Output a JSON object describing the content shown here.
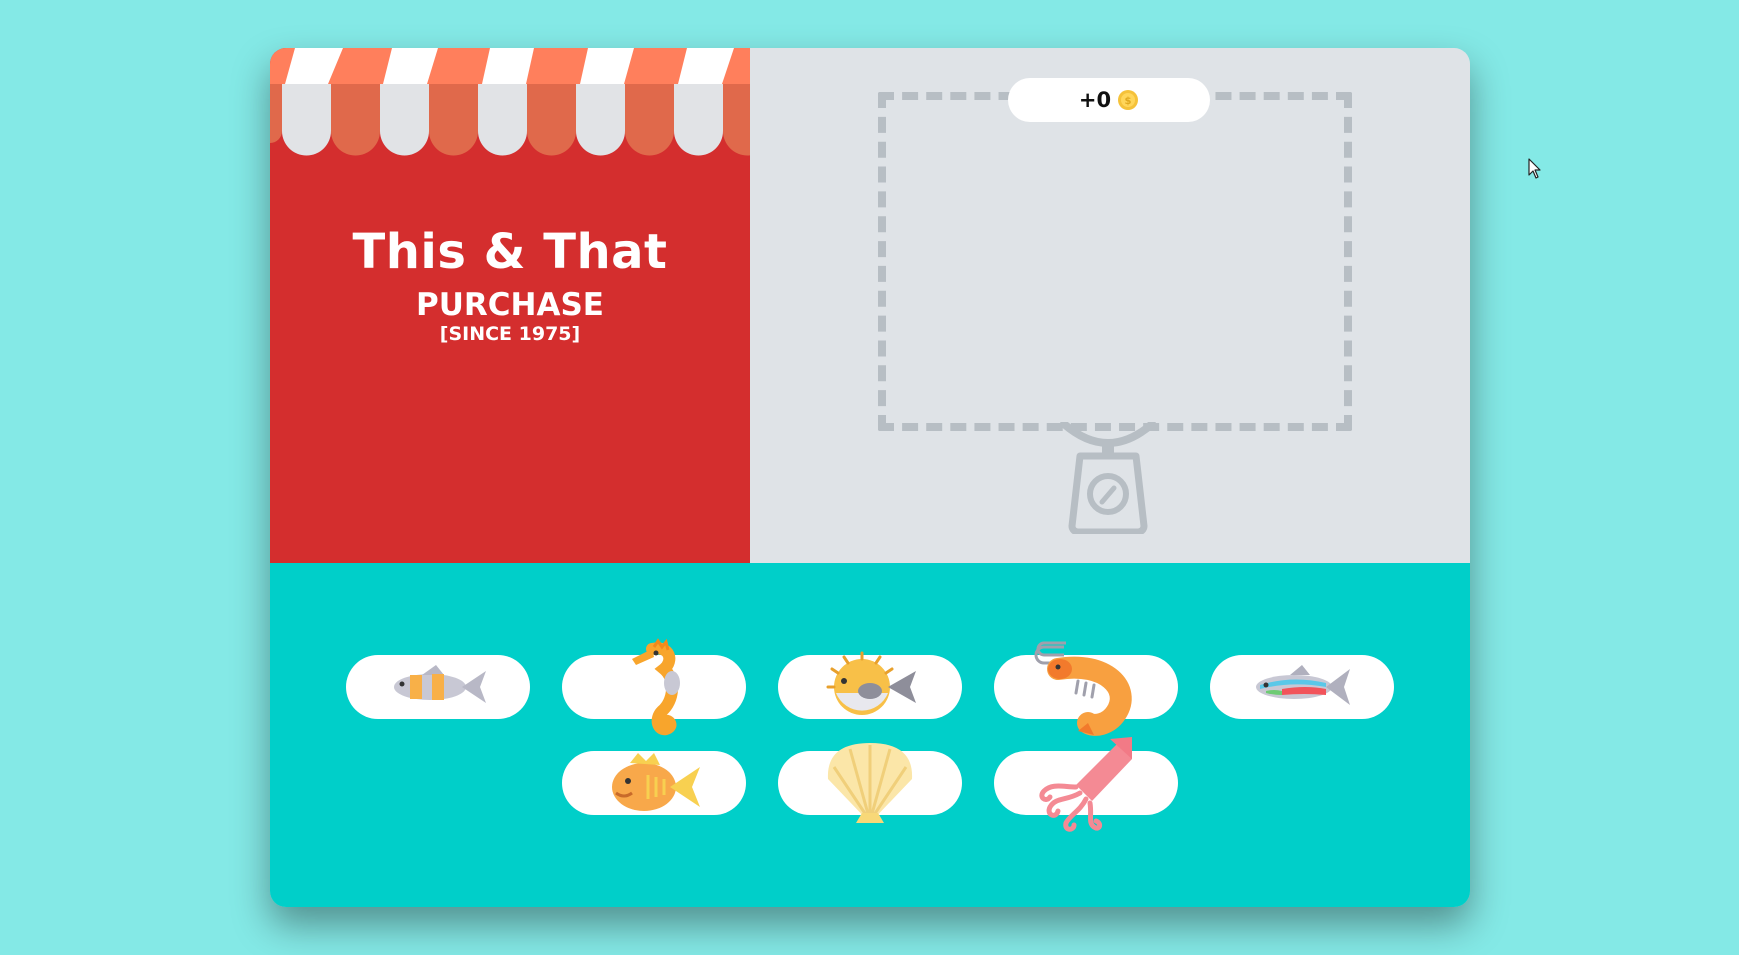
{
  "shop": {
    "title": "This & That",
    "subtitle": "PURCHASE",
    "since": "[SINCE 1975]",
    "awning_colors": [
      "#ff7f5c",
      "#ffffff"
    ]
  },
  "scale": {
    "coins": "+0"
  },
  "items": [
    {
      "icon": "striped-fish-icon",
      "label": "striped fish"
    },
    {
      "icon": "seahorse-icon",
      "label": "seahorse"
    },
    {
      "icon": "pufferfish-icon",
      "label": "pufferfish"
    },
    {
      "icon": "shrimp-icon",
      "label": "shrimp"
    },
    {
      "icon": "neon-fish-icon",
      "label": "neon fish"
    },
    {
      "icon": "yellow-fish-icon",
      "label": "yellow fish"
    },
    {
      "icon": "scallop-shell-icon",
      "label": "scallop shell"
    },
    {
      "icon": "squid-icon",
      "label": "squid"
    }
  ],
  "colors": {
    "page_bg": "#84e9e6",
    "shop_red": "#d42e2e",
    "scale_bg": "#dfe3e7",
    "counter_teal": "#00cfc9",
    "dashed_gray": "#b7bec4"
  }
}
